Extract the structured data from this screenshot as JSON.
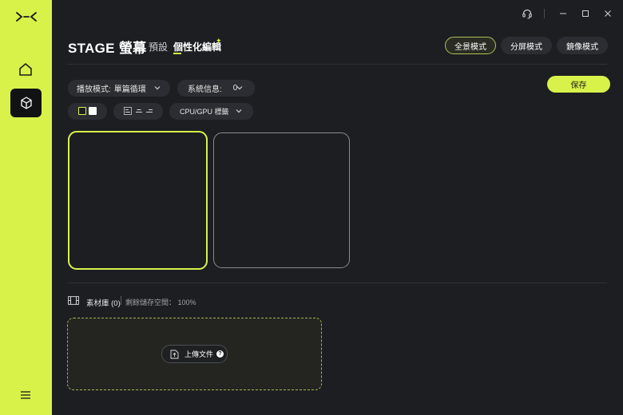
{
  "header": {
    "title": "STAGE 螢幕",
    "tabs": [
      {
        "label": "預設"
      },
      {
        "label": "個性化編輯"
      }
    ]
  },
  "modes": [
    {
      "label": "全景模式",
      "active": true
    },
    {
      "label": "分屏模式",
      "active": false
    },
    {
      "label": "鏡像模式",
      "active": false
    }
  ],
  "toolbar": {
    "playback_label": "播放模式:",
    "playback_value": "單篇循環",
    "sysinfo_label": "系統信息:",
    "sysinfo_value": "0",
    "cpu_label": "CPU/GPU 標籤",
    "save_label": "保存"
  },
  "library": {
    "label": "素材庫 (0)",
    "space": "剩餘儲存空間： 100%",
    "upload_label": "上傳文件"
  },
  "colors": {
    "accent": "#d8f24a",
    "background": "#1c1e22",
    "pill": "#2b2d32"
  },
  "icons": [
    "logo-icon",
    "home-icon",
    "cube-icon",
    "menu-icon",
    "headset-icon",
    "minimize-icon",
    "maximize-icon",
    "close-icon",
    "filmstrip-icon",
    "upload-icon",
    "help-icon",
    "chevron-down-icon"
  ]
}
